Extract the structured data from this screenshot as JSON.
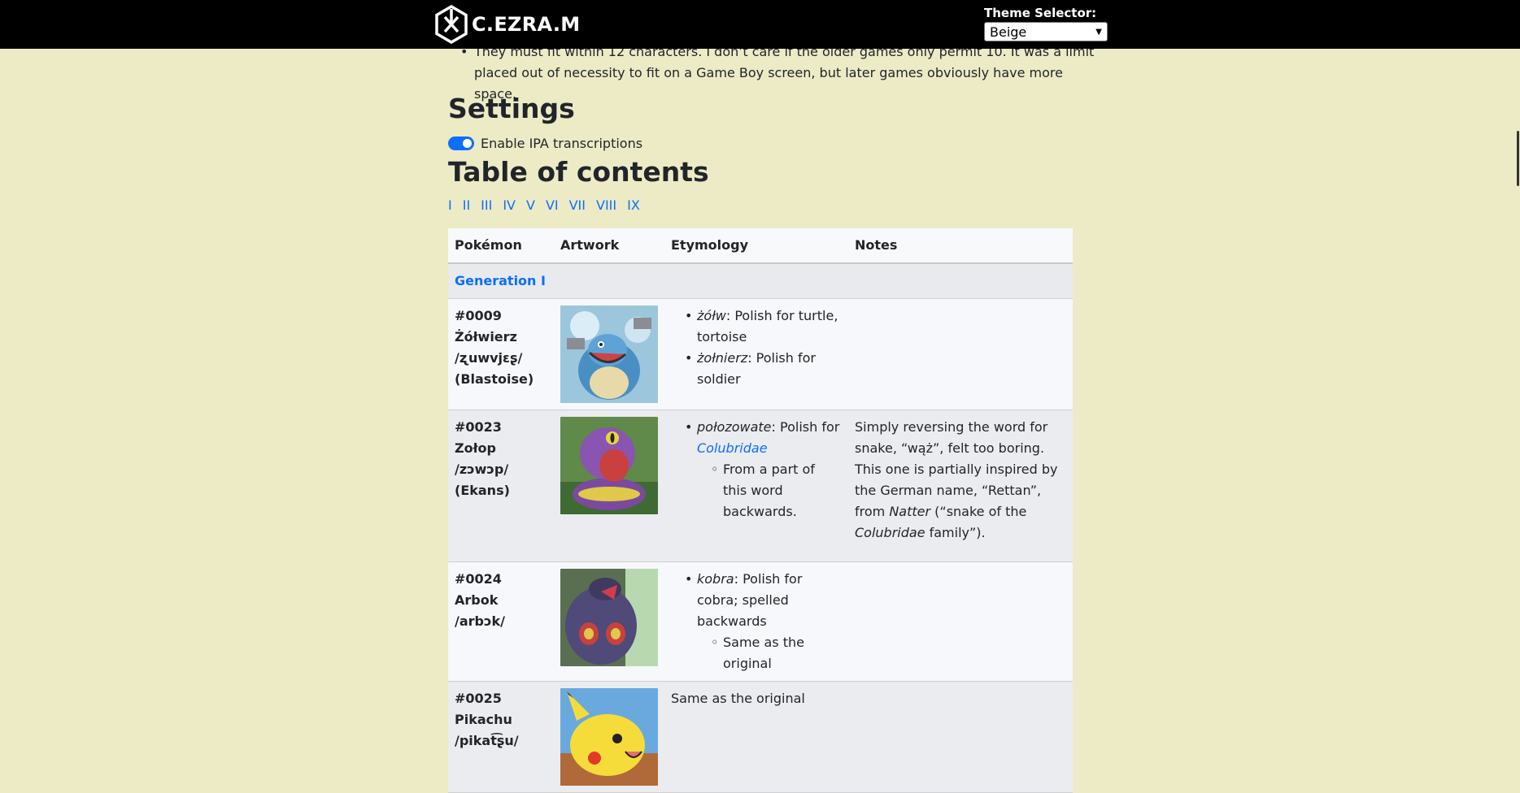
{
  "header": {
    "brand": "C.EZRA.M",
    "theme_label": "Theme Selector:",
    "theme_value": "Beige"
  },
  "intro": {
    "bullet": "They must fit within 12 characters. I don’t care if the older games only permit 10. It was a limit placed out of necessity to fit on a Game Boy screen, but later games obviously have more space."
  },
  "settings": {
    "title": "Settings",
    "ipa_toggle_label": "Enable IPA transcriptions",
    "ipa_enabled": true
  },
  "toc": {
    "title": "Table of contents",
    "links": [
      "I",
      "II",
      "III",
      "IV",
      "V",
      "VI",
      "VII",
      "VIII",
      "IX"
    ]
  },
  "table": {
    "headers": [
      "Pokémon",
      "Artwork",
      "Etymology",
      "Notes"
    ],
    "generation_label": "Generation I",
    "rows": [
      {
        "number": "#0009",
        "name": "Żółwierz",
        "ipa": "/ʐuwvjɛʂ/",
        "original": "(Blastoise)",
        "ety1_word": "żółw",
        "ety1_text": ": Polish for turtle, tortoise",
        "ety2_word": "żołnierz",
        "ety2_text": ": Polish for soldier"
      },
      {
        "number": "#0023",
        "name": "Zołop",
        "ipa": "/zɔwɔp/",
        "original": "(Ekans)",
        "ety1_word": "połozowate",
        "ety1_text": ": Polish for ",
        "ety1_link": "Colubridae",
        "ety1_sub": "From a part of this word backwards.",
        "notes_1": "Simply reversing the word for snake, “wąż”, felt too boring. This one is partially inspired by the German name, “Rettan”, from ",
        "notes_i1": "Natter",
        "notes_2": " (“snake of the ",
        "notes_i2": "Colubridae",
        "notes_3": " family”)."
      },
      {
        "number": "#0024",
        "name": "Arbok",
        "ipa": "/arbɔk/",
        "ety1_word": "kobra",
        "ety1_text": ": Polish for cobra; spelled backwards",
        "ety1_sub": "Same as the original"
      },
      {
        "number": "#0025",
        "name": "Pikachu",
        "ipa": "/pikat͡ʂu/",
        "ety_plain": "Same as the original"
      }
    ]
  },
  "colors": {
    "background": "#ecebc6",
    "topbar": "#000000",
    "accent": "#0d6efd"
  }
}
